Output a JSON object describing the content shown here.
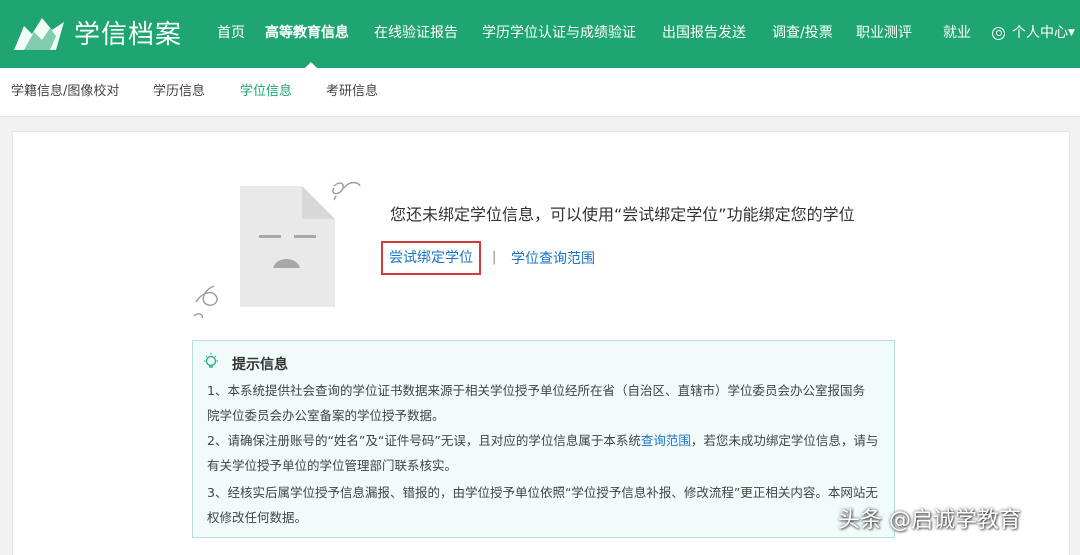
{
  "header": {
    "brand": "学信档案",
    "nav": [
      {
        "label": "首页"
      },
      {
        "label": "高等教育信息"
      },
      {
        "label": "在线验证报告"
      },
      {
        "label": "学历学位认证与成绩验证"
      },
      {
        "label": "出国报告发送"
      },
      {
        "label": "调查/投票"
      },
      {
        "label": "职业测评"
      },
      {
        "label": "就业"
      }
    ],
    "user_menu": "个人中心",
    "active_nav": "高等教育信息"
  },
  "subnav": {
    "items": [
      {
        "label": "学籍信息/图像校对"
      },
      {
        "label": "学历信息"
      },
      {
        "label": "学位信息"
      },
      {
        "label": "考研信息"
      }
    ],
    "active": "学位信息"
  },
  "main": {
    "message": "您还未绑定学位信息，可以使用“尝试绑定学位”功能绑定您的学位",
    "try_bind_label": "尝试绑定学位",
    "separator": "|",
    "scope_link_label": "学位查询范围"
  },
  "tips": {
    "title": "提示信息",
    "line1": "1、本系统提供社会查询的学位证书数据来源于相关学位授予单位经所在省（自治区、直辖市）学位委员会办公室报国务",
    "line2": "院学位委员会办公室备案的学位授予数据。",
    "line3_pre": "2、请确保注册账号的“姓名”及“证件号码”无误，且对应的学位信息属于本系统",
    "line3_link": "查询范围",
    "line3_post": "，若您未成功绑定学位信息，请与",
    "line4": "有关学位授予单位的学位管理部门联系核实。",
    "line5": "3、经核实后属学位授予信息漏报、错报的，由学位授予单位依照“学位授予信息补报、修改流程”更正相关内容。本网站无",
    "line6": "权修改任何数据。"
  },
  "watermark": "头条 @启诚学教育",
  "colors": {
    "brand_green": "#1fa572",
    "link_blue": "#1a73c9",
    "highlight_red": "#d43a3a",
    "tips_bg": "#f0fbfa"
  },
  "icons": [
    "logo-icon",
    "user-icon",
    "chevron-down-icon",
    "empty-document-illustration",
    "lightbulb-icon"
  ]
}
